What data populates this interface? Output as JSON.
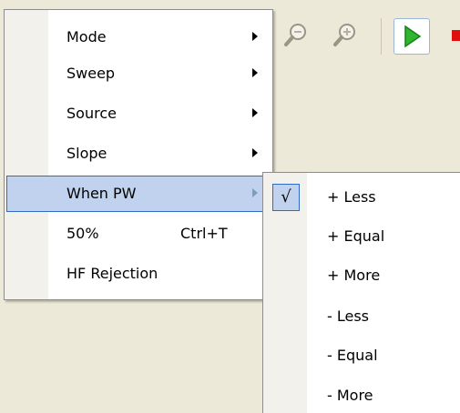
{
  "menu": {
    "items": [
      {
        "label": "Mode",
        "shortcut": "",
        "has_submenu": true
      },
      {
        "label": "Sweep",
        "shortcut": "",
        "has_submenu": true
      },
      {
        "label": "Source",
        "shortcut": "",
        "has_submenu": true
      },
      {
        "label": "Slope",
        "shortcut": "",
        "has_submenu": true
      },
      {
        "label": "When PW",
        "shortcut": "",
        "has_submenu": true,
        "highlighted": true
      },
      {
        "label": "50%",
        "shortcut": "Ctrl+T",
        "has_submenu": false
      },
      {
        "label": "HF Rejection",
        "shortcut": "",
        "has_submenu": false
      }
    ]
  },
  "submenu": {
    "check_mark": "√",
    "items": [
      {
        "label": "+ Less",
        "checked": true
      },
      {
        "label": "+ Equal",
        "checked": false
      },
      {
        "label": "+ More",
        "checked": false
      },
      {
        "label": "- Less",
        "checked": false
      },
      {
        "label": "- Equal",
        "checked": false
      },
      {
        "label": "- More",
        "checked": false
      }
    ]
  },
  "toolbar": {
    "icons": [
      "zoom-out-icon",
      "zoom-in-icon",
      "play-icon",
      "stop-icon"
    ]
  },
  "colors": {
    "highlight_bg": "#c1d2ee",
    "highlight_border": "#316ac5",
    "play_green": "#2fb52f",
    "stop_red": "#e01010"
  }
}
